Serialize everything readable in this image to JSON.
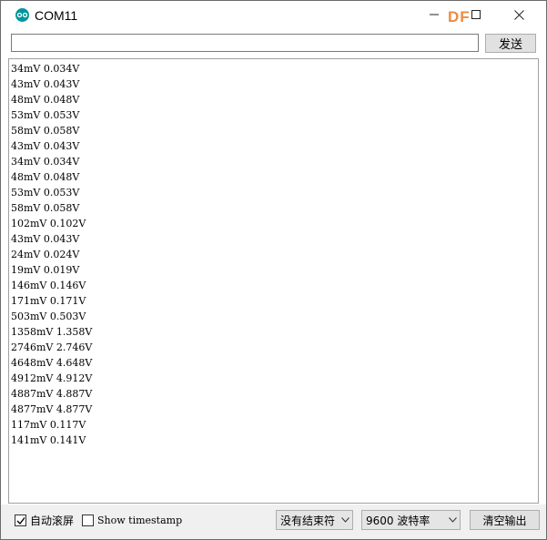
{
  "window": {
    "title": "COM11",
    "watermark": "DF"
  },
  "send_bar": {
    "input_value": "",
    "send_label": "发送"
  },
  "output": {
    "lines": [
      "34mV 0.034V",
      "43mV 0.043V",
      "48mV 0.048V",
      "53mV 0.053V",
      "58mV 0.058V",
      "43mV 0.043V",
      "34mV 0.034V",
      "48mV 0.048V",
      "53mV 0.053V",
      "58mV 0.058V",
      "102mV 0.102V",
      "43mV 0.043V",
      "24mV 0.024V",
      "19mV 0.019V",
      "146mV 0.146V",
      "171mV 0.171V",
      "503mV 0.503V",
      "1358mV 1.358V",
      "2746mV 2.746V",
      "4648mV 4.648V",
      "4912mV 4.912V",
      "4887mV 4.887V",
      "4877mV 4.877V",
      "117mV 0.117V",
      "141mV 0.141V"
    ]
  },
  "bottom_bar": {
    "autoscroll_label": "自动滚屏",
    "autoscroll_checked": true,
    "timestamp_label": "Show timestamp",
    "timestamp_checked": false,
    "line_ending_value": "没有结束符",
    "baud_value": "9600 波特率",
    "clear_label": "清空输出"
  },
  "colors": {
    "app_icon": "#00979c",
    "watermark": "#f08a3e"
  },
  "icons": {
    "app": "arduino-icon",
    "minimize": "minimize-icon",
    "maximize": "maximize-icon",
    "close": "close-icon",
    "dropdown": "chevron-down-icon",
    "check": "check-icon"
  }
}
